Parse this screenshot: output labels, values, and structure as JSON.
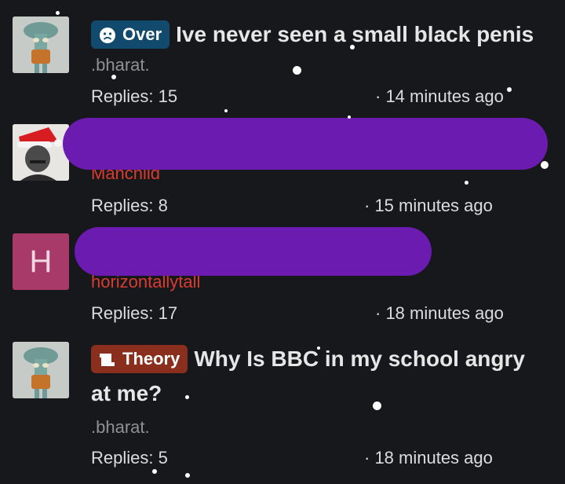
{
  "posts": [
    {
      "tag": "Over",
      "tag_icon": "sad-face-icon",
      "title": "Ive never seen a small black penis",
      "author": ".bharat.",
      "replies": "Replies: 15",
      "time": "· 14 minutes ago",
      "avatar": "squidward-avatar"
    },
    {
      "author": "Manchild",
      "replies": "Replies: 8",
      "time": "· 15 minutes ago",
      "avatar": "santa-hat-portrait-avatar"
    },
    {
      "avatar_letter": "H",
      "author": "horizontallytall",
      "replies": "Replies: 17",
      "time": "· 18 minutes ago"
    },
    {
      "tag": "Theory",
      "tag_icon": "scroll-icon",
      "title_line1": "Why Is BBC in my school angry",
      "title_line2": "at me?",
      "author": ".bharat.",
      "replies": "Replies: 5",
      "time": "· 18 minutes ago",
      "avatar": "squidward-avatar"
    }
  ],
  "colors": {
    "background": "#17181b",
    "redaction": "#6c1bb0",
    "over_tag": "#124a6d",
    "theory_tag": "#8a2e1e",
    "username_red": "#d93b31",
    "avatar_h_bg": "#a83a6a"
  }
}
